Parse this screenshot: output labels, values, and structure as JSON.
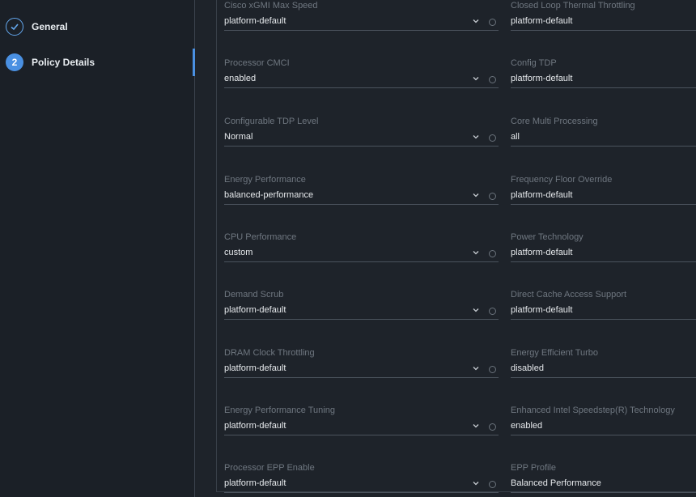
{
  "sidebar": {
    "steps": [
      {
        "label": "General",
        "state": "done",
        "icon": "check-icon"
      },
      {
        "label": "Policy Details",
        "number": "2",
        "state": "current"
      }
    ]
  },
  "form": {
    "rows": [
      {
        "left": {
          "label": "Cisco xGMI Max Speed",
          "value": "platform-default"
        },
        "right": {
          "label": "Closed Loop Thermal Throttling",
          "value": "platform-default"
        }
      },
      {
        "left": {
          "label": "Processor CMCI",
          "value": "enabled"
        },
        "right": {
          "label": "Config TDP",
          "value": "platform-default"
        }
      },
      {
        "left": {
          "label": "Configurable TDP Level",
          "value": "Normal"
        },
        "right": {
          "label": "Core Multi Processing",
          "value": "all"
        }
      },
      {
        "left": {
          "label": "Energy Performance",
          "value": "balanced-performance"
        },
        "right": {
          "label": "Frequency Floor Override",
          "value": "platform-default"
        }
      },
      {
        "left": {
          "label": "CPU Performance",
          "value": "custom"
        },
        "right": {
          "label": "Power Technology",
          "value": "platform-default"
        }
      },
      {
        "left": {
          "label": "Demand Scrub",
          "value": "platform-default"
        },
        "right": {
          "label": "Direct Cache Access Support",
          "value": "platform-default"
        }
      },
      {
        "left": {
          "label": "DRAM Clock Throttling",
          "value": "platform-default"
        },
        "right": {
          "label": "Energy Efficient Turbo",
          "value": "disabled"
        }
      },
      {
        "left": {
          "label": "Energy Performance Tuning",
          "value": "platform-default"
        },
        "right": {
          "label": "Enhanced Intel Speedstep(R) Technology",
          "value": "enabled"
        }
      },
      {
        "left": {
          "label": "Processor EPP Enable",
          "value": "platform-default"
        },
        "right": {
          "label": "EPP Profile",
          "value": "Balanced Performance"
        }
      }
    ]
  },
  "colors": {
    "accent": "#4a90e2",
    "background": "#1e232a"
  }
}
